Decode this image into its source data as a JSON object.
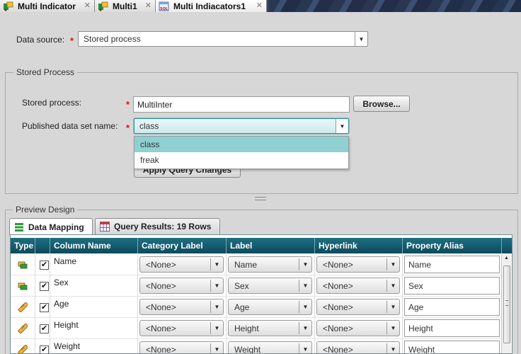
{
  "doc_tabs": [
    {
      "label": "Multi Indicator"
    },
    {
      "label": "Multi1"
    },
    {
      "label": "Multi Indiacators1"
    }
  ],
  "data_source": {
    "label": "Data source:",
    "value": "Stored process"
  },
  "stored_process_group": {
    "title": "Stored Process",
    "stored_process_label": "Stored process:",
    "stored_process_value": "MultiInter",
    "browse_label": "Browse...",
    "published_label": "Published data set name:",
    "published_value": "class",
    "apply_label": "Apply Query Changes",
    "dropdown_options": [
      "class",
      "freak"
    ]
  },
  "preview": {
    "title": "Preview Design",
    "tabs": [
      {
        "label": "Data Mapping"
      },
      {
        "label": "Query Results: 19 Rows"
      }
    ]
  },
  "grid": {
    "headers": [
      "Type",
      "",
      "Column Name",
      "Category Label",
      "Label",
      "Hyperlink",
      "Property Alias"
    ],
    "rows": [
      {
        "type_icon": "character-type-icon",
        "checked": "✔",
        "column": "Name",
        "category": "<None>",
        "label": "Name",
        "hyperlink": "<None>",
        "alias": "Name"
      },
      {
        "type_icon": "character-type-icon",
        "checked": "✔",
        "column": "Sex",
        "category": "<None>",
        "label": "Sex",
        "hyperlink": "<None>",
        "alias": "Sex"
      },
      {
        "type_icon": "numeric-type-icon",
        "checked": "✔",
        "column": "Age",
        "category": "<None>",
        "label": "Age",
        "hyperlink": "<None>",
        "alias": "Age"
      },
      {
        "type_icon": "numeric-type-icon",
        "checked": "✔",
        "column": "Height",
        "category": "<None>",
        "label": "Height",
        "hyperlink": "<None>",
        "alias": "Height"
      },
      {
        "type_icon": "numeric-type-icon",
        "checked": "✔",
        "column": "Weight",
        "category": "<None>",
        "label": "Weight",
        "hyperlink": "<None>",
        "alias": "Weight"
      }
    ]
  },
  "colors": {
    "header_teal": "#0d4a5c",
    "selection": "#8fd0d2",
    "required": "#d11111"
  }
}
